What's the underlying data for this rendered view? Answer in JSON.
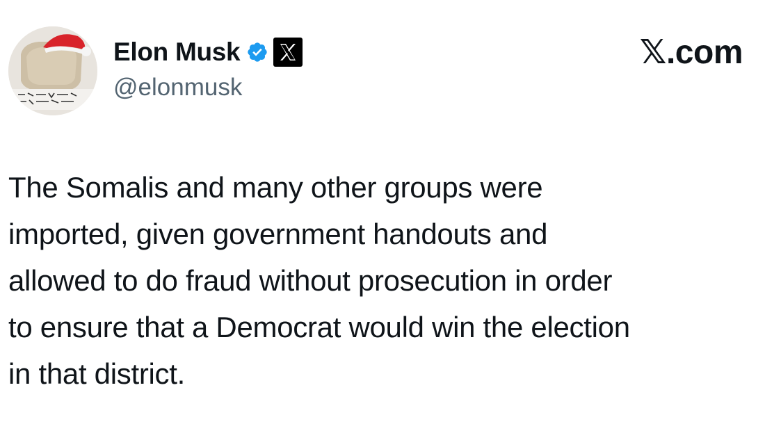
{
  "tweet": {
    "author": {
      "display_name": "Elon Musk",
      "handle": "@elonmusk",
      "avatar_icon": "avatar-image",
      "verified_icon": "verified-badge-icon",
      "affiliate_icon": "x-logo-icon"
    },
    "brand": "𝕏.com",
    "text_lines": [
      "The Somalis and many other groups were",
      "imported, given government handouts and",
      "allowed to do fraud without prosecution in order",
      "to ensure that a Democrat would win the election",
      "in that district."
    ]
  },
  "colors": {
    "text": "#0f1419",
    "secondary_text": "#536471",
    "verified_blue": "#1d9bf0",
    "background": "#ffffff"
  }
}
